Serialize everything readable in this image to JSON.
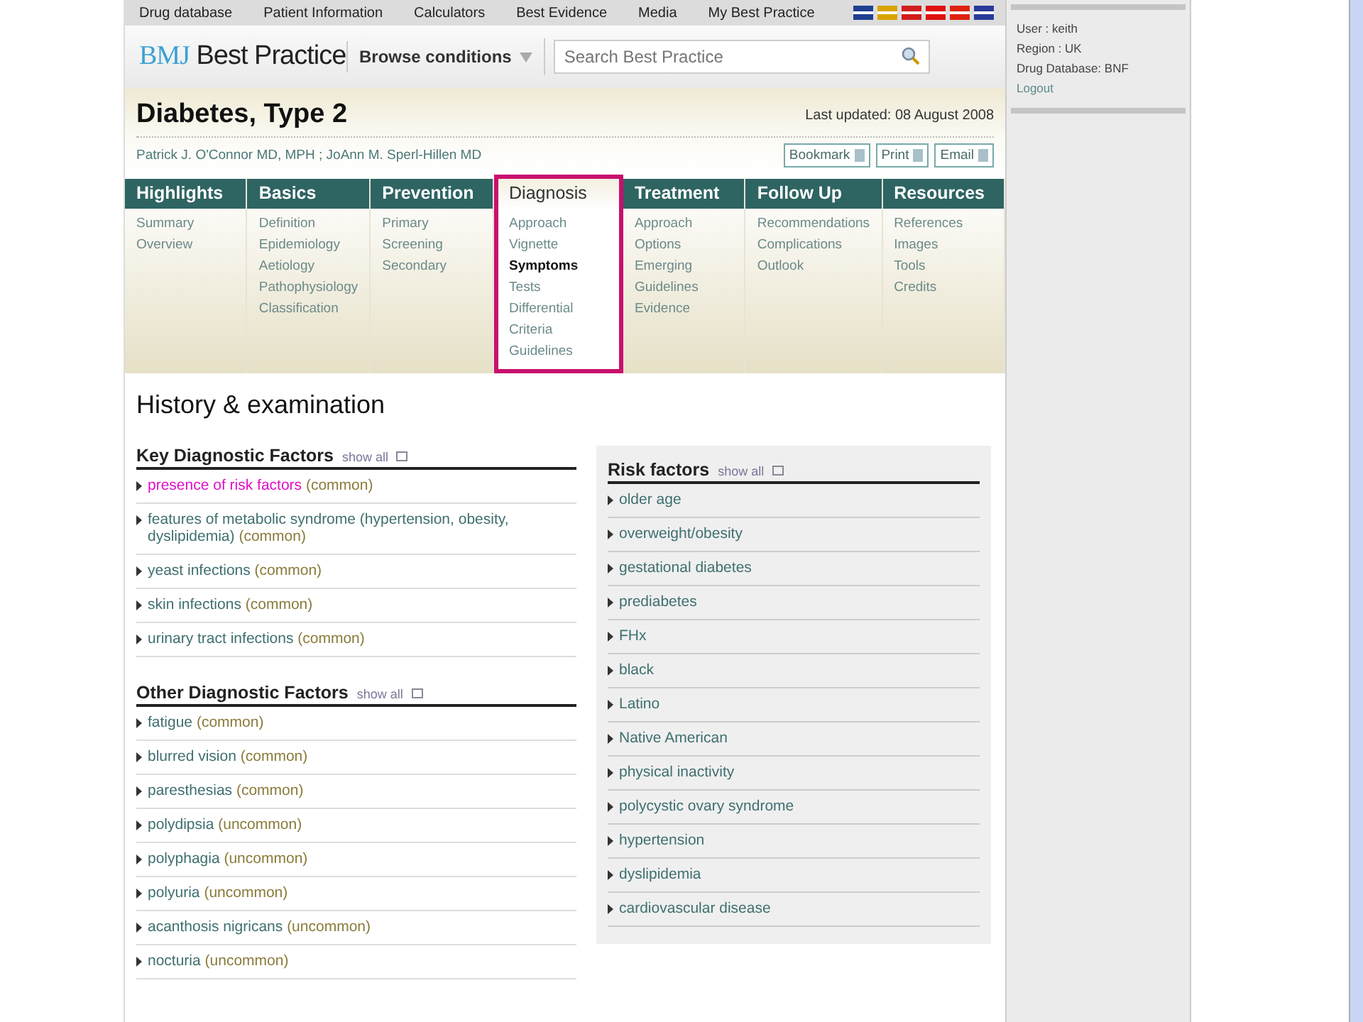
{
  "top_nav": [
    "Drug database",
    "Patient Information",
    "Calculators",
    "Best Evidence",
    "Media",
    "My Best Practice"
  ],
  "flags": [
    {
      "color": "#1f3f8f"
    },
    {
      "color": "#d8a400"
    },
    {
      "color": "#d01c1c"
    },
    {
      "color": "#e01010"
    },
    {
      "color": "#e02010"
    },
    {
      "color": "#2a3a9a"
    }
  ],
  "logo": {
    "mark": "BMJ",
    "name": "Best Practice"
  },
  "browse": "Browse conditions",
  "search": {
    "placeholder": "Search Best Practice"
  },
  "title": "Diabetes, Type 2",
  "last_updated": "Last updated: 08 August 2008",
  "authors": "Patrick J. O'Connor MD, MPH ; JoAnn M. Sperl-Hillen MD",
  "actions": [
    "Bookmark",
    "Print",
    "Email"
  ],
  "menu": [
    {
      "label": "Highlights",
      "selected": false,
      "items": [
        {
          "label": "Summary",
          "current": false
        },
        {
          "label": "Overview",
          "current": false
        }
      ]
    },
    {
      "label": "Basics",
      "selected": false,
      "items": [
        {
          "label": "Definition",
          "current": false
        },
        {
          "label": "Epidemiology",
          "current": false
        },
        {
          "label": "Aetiology",
          "current": false
        },
        {
          "label": "Pathophysiology",
          "current": false
        },
        {
          "label": "Classification",
          "current": false
        }
      ]
    },
    {
      "label": "Prevention",
      "selected": false,
      "items": [
        {
          "label": "Primary",
          "current": false
        },
        {
          "label": "Screening",
          "current": false
        },
        {
          "label": "Secondary",
          "current": false
        }
      ]
    },
    {
      "label": "Diagnosis",
      "selected": true,
      "items": [
        {
          "label": "Approach",
          "current": false
        },
        {
          "label": "Vignette",
          "current": false
        },
        {
          "label": "Symptoms",
          "current": true
        },
        {
          "label": "Tests",
          "current": false
        },
        {
          "label": "Differential",
          "current": false
        },
        {
          "label": "Criteria",
          "current": false
        },
        {
          "label": "Guidelines",
          "current": false
        }
      ]
    },
    {
      "label": "Treatment",
      "selected": false,
      "items": [
        {
          "label": "Approach",
          "current": false
        },
        {
          "label": "Options",
          "current": false
        },
        {
          "label": "Emerging",
          "current": false
        },
        {
          "label": "Guidelines",
          "current": false
        },
        {
          "label": "Evidence",
          "current": false
        }
      ]
    },
    {
      "label": "Follow Up",
      "selected": false,
      "items": [
        {
          "label": "Recommendations",
          "current": false
        },
        {
          "label": "Complications",
          "current": false
        },
        {
          "label": "Outlook",
          "current": false
        }
      ]
    },
    {
      "label": "Resources",
      "selected": false,
      "items": [
        {
          "label": "References",
          "current": false
        },
        {
          "label": "Images",
          "current": false
        },
        {
          "label": "Tools",
          "current": false
        },
        {
          "label": "Credits",
          "current": false
        }
      ]
    }
  ],
  "section_title": "History & examination",
  "key_factors": {
    "title": "Key Diagnostic Factors",
    "show_all": "show all",
    "items": [
      {
        "name": "presence of risk factors",
        "freq": "(common)",
        "highlighted": true
      },
      {
        "name": "features of metabolic syndrome (hypertension, obesity, dyslipidemia)",
        "freq": "(common)",
        "highlighted": false
      },
      {
        "name": "yeast infections",
        "freq": "(common)",
        "highlighted": false
      },
      {
        "name": "skin infections",
        "freq": "(common)",
        "highlighted": false
      },
      {
        "name": "urinary tract infections",
        "freq": "(common)",
        "highlighted": false
      }
    ]
  },
  "other_factors": {
    "title": "Other Diagnostic Factors",
    "show_all": "show all",
    "items": [
      {
        "name": "fatigue",
        "freq": "(common)",
        "highlighted": false
      },
      {
        "name": "blurred vision",
        "freq": "(common)",
        "highlighted": false
      },
      {
        "name": "paresthesias",
        "freq": "(common)",
        "highlighted": false
      },
      {
        "name": "polydipsia",
        "freq": "(uncommon)",
        "highlighted": false
      },
      {
        "name": "polyphagia",
        "freq": "(uncommon)",
        "highlighted": false
      },
      {
        "name": "polyuria",
        "freq": "(uncommon)",
        "highlighted": false
      },
      {
        "name": "acanthosis nigricans",
        "freq": "(uncommon)",
        "highlighted": false
      },
      {
        "name": "nocturia",
        "freq": "(uncommon)",
        "highlighted": false
      }
    ]
  },
  "risk_factors": {
    "title": "Risk factors",
    "show_all": "show all",
    "items": [
      "older age",
      "overweight/obesity",
      "gestational diabetes",
      "prediabetes",
      "FHx",
      "black",
      "Latino",
      "Native American",
      "physical inactivity",
      "polycystic ovary syndrome",
      "hypertension",
      "dyslipidemia",
      "cardiovascular disease"
    ]
  },
  "user_panel": {
    "lines": [
      "User : keith",
      "Region : UK",
      "Drug Database: BNF"
    ],
    "logout": "Logout"
  }
}
